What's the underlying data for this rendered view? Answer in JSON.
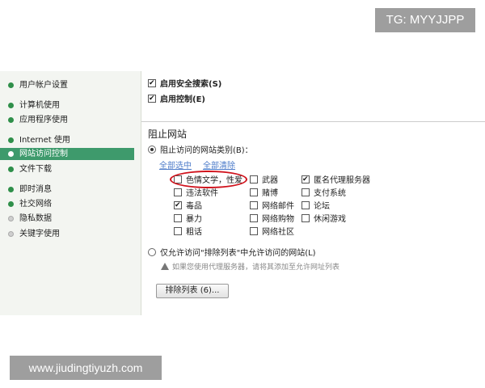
{
  "watermarks": {
    "top": "TG: MYYJJPP",
    "bottom": "www.jiudingtiyuzh.com"
  },
  "sidebar": {
    "items": [
      {
        "label": "用户帐户设置"
      },
      {
        "label": "计算机使用"
      },
      {
        "label": "应用程序使用"
      },
      {
        "label": "Internet 使用"
      },
      {
        "label": "网站访问控制"
      },
      {
        "label": "文件下载"
      },
      {
        "label": "即时消息"
      },
      {
        "label": "社交网络"
      },
      {
        "label": "隐私数据"
      },
      {
        "label": "关键字使用"
      }
    ]
  },
  "main": {
    "safe_search": {
      "label": "启用安全搜索(S)",
      "checked": true
    },
    "enable_control": {
      "label": "启用控制(E)",
      "checked": true
    },
    "block_title": "阻止网站",
    "block_categories_radio": "阻止访问的网站类别(B)：",
    "select_all": "全部选中",
    "clear_all": "全部清除",
    "categories": {
      "c1": "色情文学，性爱",
      "c2": "违法软件",
      "c3": "毒品",
      "c4": "暴力",
      "c5": "粗话",
      "c6": "武器",
      "c7": "赌博",
      "c8": "网络邮件",
      "c9": "网络购物",
      "c10": "网络社区",
      "c11": "匿名代理服务器",
      "c12": "支付系统",
      "c13": "论坛",
      "c14": "休闲游戏"
    },
    "allow_radio": "仅允许访问\"排除列表\"中允许访问的网站(L)",
    "proxy_note": "如果您使用代理服务器，请将其添加至允许网址列表",
    "exclusion_button": "排除列表 (6)..."
  }
}
